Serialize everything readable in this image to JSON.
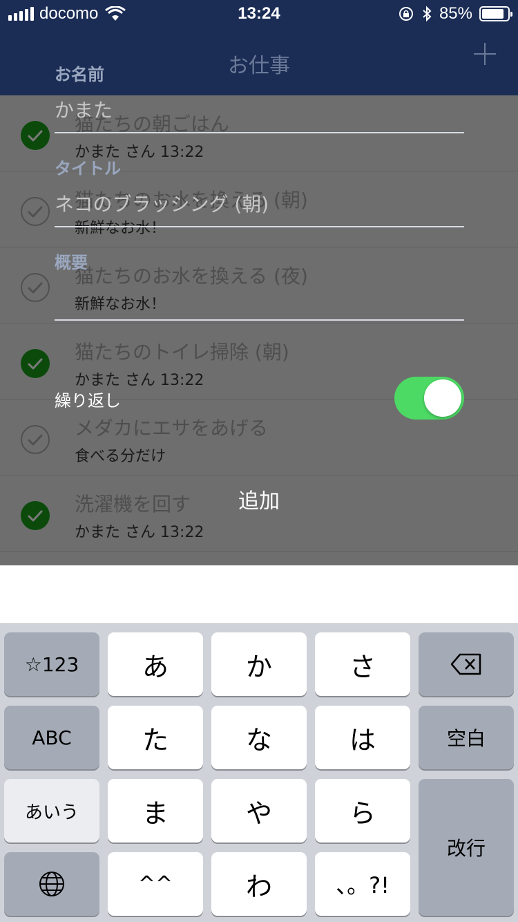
{
  "status_bar": {
    "carrier": "docomo",
    "time": "13:24",
    "battery": "85%",
    "battery_level": 0.85,
    "icons": [
      "signal-icon",
      "wifi-icon",
      "rotation-lock-icon",
      "bluetooth-icon",
      "battery-icon"
    ]
  },
  "nav": {
    "title": "お仕事",
    "add_icon": "plus-icon"
  },
  "tasks": [
    {
      "title": "猫たちの朝ごはん",
      "sub": "かまた さん 13:22",
      "done": true
    },
    {
      "title": "猫たちのお水を換える (朝)",
      "sub": "新鮮なお水！",
      "done": false
    },
    {
      "title": "猫たちのお水を換える (夜)",
      "sub": "新鮮なお水！",
      "done": false
    },
    {
      "title": "猫たちのトイレ掃除 (朝)",
      "sub": "かまた さん 13:22",
      "done": true
    },
    {
      "title": "メダカにエサをあげる",
      "sub": "食べる分だけ",
      "done": false
    },
    {
      "title": "洗濯機を回す",
      "sub": "かまた さん 13:22",
      "done": true
    }
  ],
  "form": {
    "name_label": "お名前",
    "name_value": "かまた",
    "title_label": "タイトル",
    "title_value": "ネコのブラッシング (朝)",
    "summary_label": "概要",
    "summary_value": "",
    "repeat_label": "繰り返し",
    "repeat_on": true,
    "add_button": "追加"
  },
  "keyboard": {
    "rows": [
      [
        "☆123",
        "あ",
        "か",
        "さ",
        "⌫"
      ],
      [
        "ABC",
        "た",
        "な",
        "は",
        "空白"
      ],
      [
        "あいう",
        "ま",
        "や",
        "ら",
        "改行"
      ],
      [
        "globe",
        "^^",
        "わ",
        "、。?!"
      ]
    ],
    "sym": "☆123",
    "abc": "ABC",
    "kana": "あいう",
    "space": "空白",
    "return": "改行",
    "keys": [
      "あ",
      "か",
      "さ",
      "た",
      "な",
      "は",
      "ま",
      "や",
      "ら",
      "^^",
      "わ",
      "、。?!"
    ]
  },
  "colors": {
    "nav_bg": "#1b2d55",
    "toggle_on": "#4cd964",
    "check_done": "#0b4a0b"
  }
}
